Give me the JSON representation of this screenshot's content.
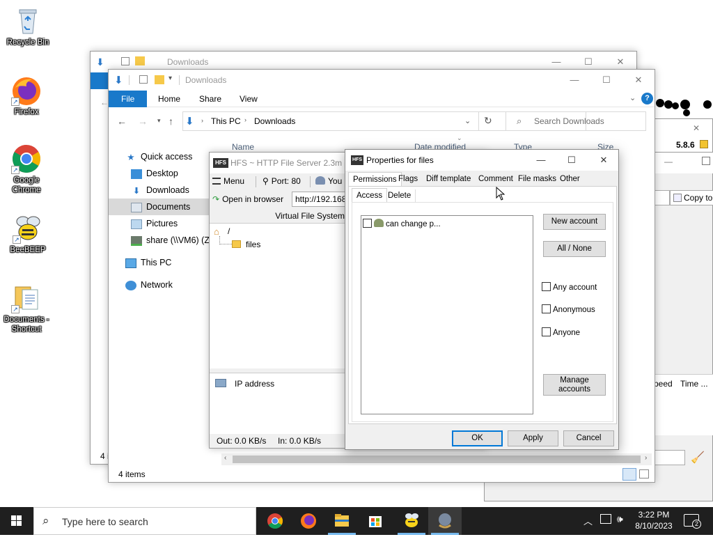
{
  "desktop": {
    "icons": [
      {
        "label": "Recycle Bin",
        "icon": "recycle-bin-icon"
      },
      {
        "label": "Firefox",
        "icon": "firefox-icon"
      },
      {
        "label": "Google Chrome",
        "icon": "chrome-icon"
      },
      {
        "label": "BeeBEEP",
        "icon": "bee-icon"
      },
      {
        "label": "Documents - Shortcut",
        "icon": "document-shortcut-icon"
      }
    ]
  },
  "explorer_back": {
    "title": "Downloads",
    "status": "4 i"
  },
  "explorer_front": {
    "title": "Downloads",
    "ribbon_tabs": [
      "File",
      "Home",
      "Share",
      "View"
    ],
    "breadcrumb": [
      "This PC",
      "Downloads"
    ],
    "search_placeholder": "Search Downloads",
    "columns": [
      "Name",
      "Date modified",
      "Type",
      "Size"
    ],
    "nav": [
      {
        "label": "Quick access",
        "icon": "star-icon"
      },
      {
        "label": "Desktop",
        "icon": "desktop-icon"
      },
      {
        "label": "Downloads",
        "icon": "download-arrow-icon"
      },
      {
        "label": "Documents",
        "icon": "documents-icon"
      },
      {
        "label": "Pictures",
        "icon": "pictures-icon"
      },
      {
        "label": "share (\\\\VM6) (Z:)",
        "icon": "network-drive-icon"
      },
      {
        "label": "This PC",
        "icon": "computer-icon"
      },
      {
        "label": "Network",
        "icon": "network-icon"
      }
    ],
    "status": "4 items"
  },
  "hfs": {
    "title": "HFS ~ HTTP File Server 2.3m",
    "menu": "Menu",
    "port": "Port: 80",
    "you": "You",
    "open_browser": "Open in browser",
    "url": "http://192.168",
    "vfs_header": "Virtual File System",
    "root": "/",
    "folder": "files",
    "ip_header": "IP address",
    "out": "Out: 0.0 KB/s",
    "in": "In: 0.0 KB/s"
  },
  "right_window": {
    "version": "5.8.6",
    "copy_to": "Copy to",
    "speed": "Speed",
    "time": "Time ..."
  },
  "dialog": {
    "title": "Properties for files",
    "tabs": [
      "Permissions",
      "Flags",
      "Diff template",
      "Comment",
      "File masks",
      "Other"
    ],
    "subtabs": [
      "Access",
      "Delete"
    ],
    "list_item": "can change p...",
    "new_account": "New account",
    "all_none": "All / None",
    "any_account": "Any account",
    "anonymous": "Anonymous",
    "anyone": "Anyone",
    "manage_accounts": "Manage accounts",
    "ok": "OK",
    "apply": "Apply",
    "cancel": "Cancel"
  },
  "taskbar": {
    "search_placeholder": "Type here to search",
    "time": "3:22 PM",
    "date": "8/10/2023",
    "notifications": "2"
  }
}
